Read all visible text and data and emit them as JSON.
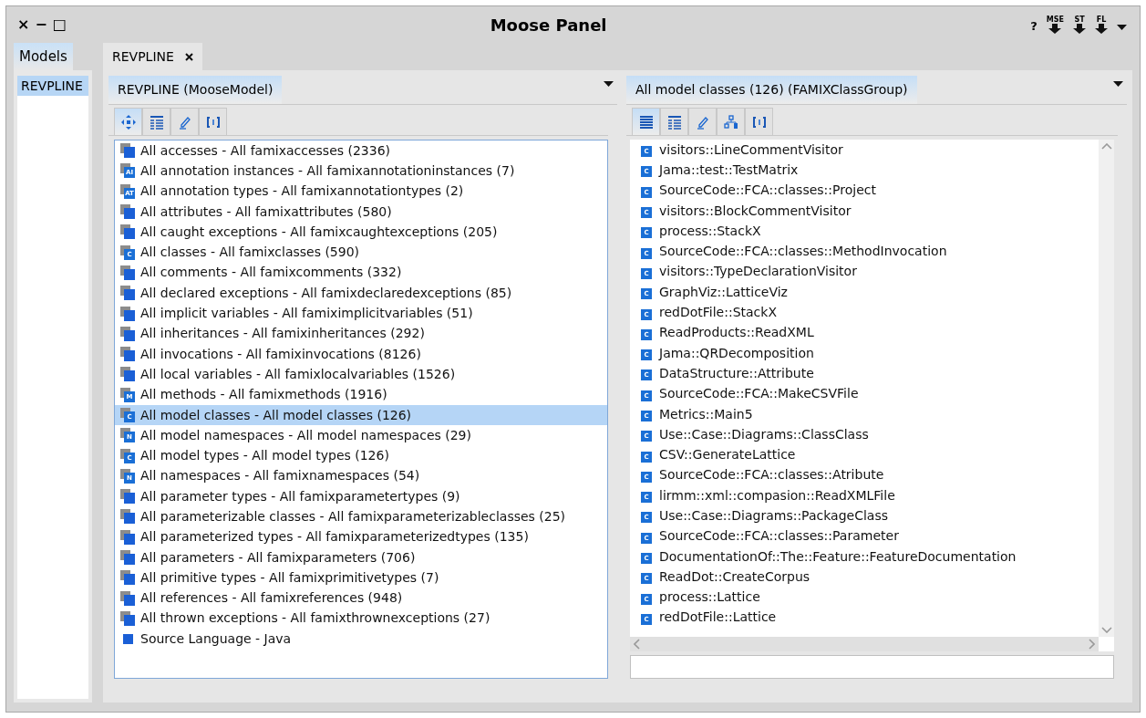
{
  "window": {
    "title": "Moose Panel",
    "controls": [
      {
        "label": "×"
      },
      {
        "label": "−"
      },
      {
        "label": "□"
      }
    ],
    "header_actions": [
      {
        "kind": "help",
        "label": "?"
      },
      {
        "kind": "export",
        "label": "MSE"
      },
      {
        "kind": "export",
        "label": "ST"
      },
      {
        "kind": "export",
        "label": "FL"
      },
      {
        "kind": "menu"
      }
    ]
  },
  "models": {
    "tab": {
      "label": "Models",
      "selected": true
    },
    "items": [
      {
        "label": "REVPLINE",
        "selected": true
      }
    ]
  },
  "main_tabs": [
    {
      "label": "REVPLINE",
      "selected": true
    }
  ],
  "left_pane": {
    "tab": {
      "label": "REVPLINE (MooseModel)",
      "selected": true
    },
    "tools": [
      {
        "kind": "navigate",
        "selected": true
      },
      {
        "kind": "table",
        "selected": false
      },
      {
        "kind": "edit",
        "selected": false
      },
      {
        "kind": "raw",
        "selected": false
      }
    ],
    "items": [
      {
        "kind": "group",
        "label": "All accesses - All famixaccesses (2336)",
        "selected": false
      },
      {
        "kind": "badge",
        "badge": "AI",
        "label": "All annotation instances - All famixannotationinstances (7)",
        "selected": false
      },
      {
        "kind": "badge",
        "badge": "AT",
        "label": "All annotation types - All famixannotationtypes (2)",
        "selected": false
      },
      {
        "kind": "group",
        "label": "All attributes - All famixattributes (580)",
        "selected": false
      },
      {
        "kind": "group",
        "label": "All caught exceptions - All famixcaughtexceptions (205)",
        "selected": false
      },
      {
        "kind": "badge",
        "badge": "C",
        "label": "All classes - All famixclasses (590)",
        "selected": false
      },
      {
        "kind": "group",
        "label": "All comments - All famixcomments (332)",
        "selected": false
      },
      {
        "kind": "group",
        "label": "All declared exceptions - All famixdeclaredexceptions (85)",
        "selected": false
      },
      {
        "kind": "group",
        "label": "All implicit variables - All famiximplicitvariables (51)",
        "selected": false
      },
      {
        "kind": "group",
        "label": "All inheritances - All famixinheritances (292)",
        "selected": false
      },
      {
        "kind": "group",
        "label": "All invocations - All famixinvocations (8126)",
        "selected": false
      },
      {
        "kind": "group",
        "label": "All local variables - All famixlocalvariables (1526)",
        "selected": false
      },
      {
        "kind": "badge",
        "badge": "M",
        "label": "All methods - All famixmethods (1916)",
        "selected": false
      },
      {
        "kind": "badge",
        "badge": "C",
        "label": "All model classes - All model classes (126)",
        "selected": true
      },
      {
        "kind": "badge",
        "badge": "N",
        "label": "All model namespaces - All model namespaces (29)",
        "selected": false
      },
      {
        "kind": "badge",
        "badge": "C",
        "label": "All model types - All model types (126)",
        "selected": false
      },
      {
        "kind": "badge",
        "badge": "N",
        "label": "All namespaces - All famixnamespaces (54)",
        "selected": false
      },
      {
        "kind": "group",
        "label": "All parameter types - All famixparametertypes (9)",
        "selected": false
      },
      {
        "kind": "group",
        "label": "All parameterizable classes - All famixparameterizableclasses (25)",
        "selected": false
      },
      {
        "kind": "group",
        "label": "All parameterized types - All famixparameterizedtypes (135)",
        "selected": false
      },
      {
        "kind": "group",
        "label": "All parameters - All famixparameters (706)",
        "selected": false
      },
      {
        "kind": "group",
        "label": "All primitive types - All famixprimitivetypes (7)",
        "selected": false
      },
      {
        "kind": "group",
        "label": "All references - All famixreferences (948)",
        "selected": false
      },
      {
        "kind": "group",
        "label": "All thrown exceptions - All famixthrownexceptions (27)",
        "selected": false
      },
      {
        "kind": "square",
        "label": "Source Language - Java",
        "selected": false
      }
    ]
  },
  "right_pane": {
    "tab": {
      "label": "All model classes (126) (FAMIXClassGroup)",
      "selected": true
    },
    "tools": [
      {
        "kind": "list",
        "selected": true
      },
      {
        "kind": "table",
        "selected": false
      },
      {
        "kind": "edit",
        "selected": false
      },
      {
        "kind": "tree",
        "selected": false
      },
      {
        "kind": "raw",
        "selected": false
      }
    ],
    "items": [
      {
        "badge": "C",
        "label": "visitors::LineCommentVisitor"
      },
      {
        "badge": "C",
        "label": "Jama::test::TestMatrix"
      },
      {
        "badge": "C",
        "label": "SourceCode::FCA::classes::Project"
      },
      {
        "badge": "C",
        "label": "visitors::BlockCommentVisitor"
      },
      {
        "badge": "C",
        "label": "process::StackX"
      },
      {
        "badge": "C",
        "label": "SourceCode::FCA::classes::MethodInvocation"
      },
      {
        "badge": "C",
        "label": "visitors::TypeDeclarationVisitor"
      },
      {
        "badge": "C",
        "label": "GraphViz::LatticeViz"
      },
      {
        "badge": "C",
        "label": "redDotFile::StackX"
      },
      {
        "badge": "C",
        "label": "ReadProducts::ReadXML"
      },
      {
        "badge": "C",
        "label": "Jama::QRDecomposition"
      },
      {
        "badge": "C",
        "label": "DataStructure::Attribute"
      },
      {
        "badge": "C",
        "label": "SourceCode::FCA::MakeCSVFile"
      },
      {
        "badge": "C",
        "label": "Metrics::Main5"
      },
      {
        "badge": "C",
        "label": "Use::Case::Diagrams::ClassClass"
      },
      {
        "badge": "C",
        "label": "CSV::GenerateLattice"
      },
      {
        "badge": "C",
        "label": "SourceCode::FCA::classes::Atribute"
      },
      {
        "badge": "C",
        "label": "lirmm::xml::compasion::ReadXMLFile"
      },
      {
        "badge": "C",
        "label": "Use::Case::Diagrams::PackageClass"
      },
      {
        "badge": "C",
        "label": "SourceCode::FCA::classes::Parameter"
      },
      {
        "badge": "C",
        "label": "DocumentationOf::The::Feature::FeatureDocumentation"
      },
      {
        "badge": "C",
        "label": "ReadDot::CreateCorpus"
      },
      {
        "badge": "C",
        "label": "process::Lattice"
      },
      {
        "badge": "C",
        "label": "redDotFile::Lattice"
      }
    ]
  }
}
